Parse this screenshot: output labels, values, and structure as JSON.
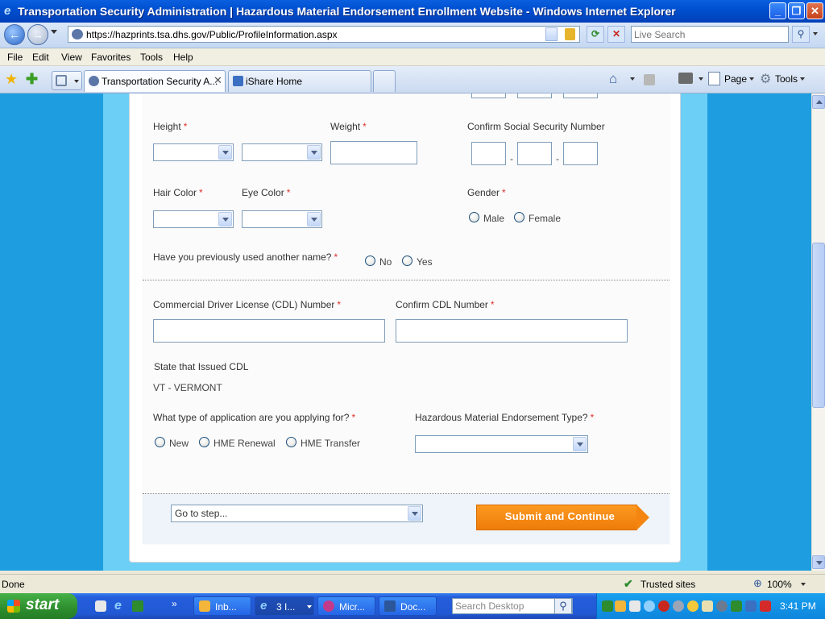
{
  "window": {
    "title": "Transportation Security Administration | Hazardous Material Endorsement Enrollment Website - Windows Internet Explorer"
  },
  "addressbar": {
    "url": "https://hazprints.tsa.dhs.gov/Public/ProfileInformation.aspx",
    "search_placeholder": "Live Search"
  },
  "menu": {
    "items": [
      "File",
      "Edit",
      "View",
      "Favorites",
      "Tools",
      "Help"
    ]
  },
  "tabs": [
    {
      "label": "Transportation Security A...",
      "active": true
    },
    {
      "label": "iShare Home",
      "active": false
    }
  ],
  "commandbar": {
    "page_label": "Page",
    "tools_label": "Tools"
  },
  "form": {
    "height_label": "Height",
    "weight_label": "Weight",
    "confirm_ssn_label": "Confirm Social Security Number",
    "ssn_separator": "-",
    "hair_color_label": "Hair Color",
    "eye_color_label": "Eye Color",
    "gender_label": "Gender",
    "gender_options": [
      "Male",
      "Female"
    ],
    "previous_name_label": "Have you previously used another name?",
    "previous_name_options": [
      "No",
      "Yes"
    ],
    "cdl_number_label": "Commercial Driver License (CDL) Number",
    "confirm_cdl_label": "Confirm CDL Number",
    "cdl_state_label": "State that Issued CDL",
    "cdl_state_value": "VT - VERMONT",
    "application_type_label": "What type of application are you applying for?",
    "application_type_options": [
      "New",
      "HME Renewal",
      "HME Transfer"
    ],
    "hme_type_label": "Hazardous Material Endorsement Type?",
    "required_marker": "*",
    "go_to_step_value": "Go to step...",
    "submit_label": "Submit and Continue"
  },
  "statusbar": {
    "status": "Done",
    "zone": "Trusted sites",
    "zoom": "100%"
  },
  "taskbar": {
    "start_label": "start",
    "buttons": [
      "Inb...",
      "3 I...",
      "Micr...",
      "Doc..."
    ],
    "search_placeholder": "Search Desktop",
    "clock": "3:41 PM"
  },
  "colors": {
    "title_bar": "#0050d0",
    "page_background": "#1e9ee0",
    "submit_button": "#f38510",
    "required_star": "#e0312c"
  }
}
